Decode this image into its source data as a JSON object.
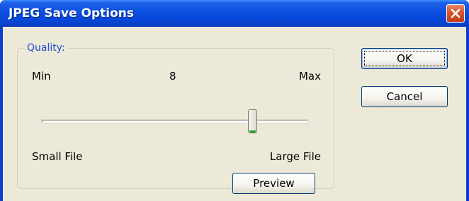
{
  "window": {
    "title": "JPEG Save Options",
    "close_icon": "close-icon"
  },
  "quality": {
    "group_label": "Quality:",
    "min_label": "Min",
    "max_label": "Max",
    "value_label": "8",
    "slider": {
      "min": 0,
      "max": 10,
      "value": 8
    },
    "small_file_label": "Small File",
    "large_file_label": "Large File",
    "preview_label": "Preview"
  },
  "buttons": {
    "ok_label": "OK",
    "cancel_label": "Cancel"
  },
  "colors": {
    "title_bar": "#0a4fe0",
    "dialog_background": "#ece9d8",
    "group_label": "#1f4fd0",
    "slider_thumb_accent": "#21a121",
    "close_button": "#d8542c"
  }
}
